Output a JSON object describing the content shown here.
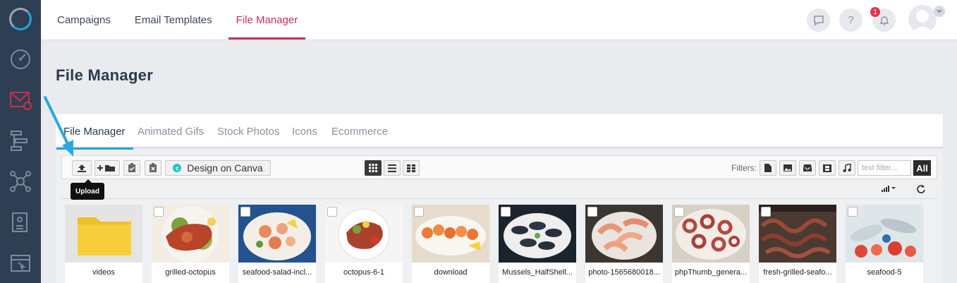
{
  "topnav": {
    "items": [
      "Campaigns",
      "Email Templates",
      "File Manager"
    ],
    "active_index": 2
  },
  "header": {
    "notification_count": "1",
    "help_icon": "?"
  },
  "page": {
    "title": "File Manager"
  },
  "tabs": [
    "File Manager",
    "Animated Gifs",
    "Stock Photos",
    "Icons",
    "Ecommerce"
  ],
  "toolbar": {
    "canva_label": "Design on Canva",
    "canva_logo_letter": "c",
    "filters_label": "Filters:",
    "text_filter_placeholder": "text filter...",
    "all_label": "All",
    "upload_tooltip": "Upload"
  },
  "files": [
    {
      "name": "videos",
      "type": "folder"
    },
    {
      "name": "grilled-octopus",
      "type": "image"
    },
    {
      "name": "seafood-salad-incl...",
      "type": "image"
    },
    {
      "name": "octopus-6-1",
      "type": "image"
    },
    {
      "name": "download",
      "type": "image"
    },
    {
      "name": "Mussels_HalfShell...",
      "type": "image"
    },
    {
      "name": "photo-1565680018...",
      "type": "image"
    },
    {
      "name": "phpThumb_genera...",
      "type": "image"
    },
    {
      "name": "fresh-grilled-seafo...",
      "type": "image"
    },
    {
      "name": "seafood-5",
      "type": "image"
    }
  ],
  "colors": {
    "sidebar": "#2f3f53",
    "accent_active": "#c4305d",
    "tab_accent": "#1ea7e1",
    "folder": "#f7cf3c"
  }
}
